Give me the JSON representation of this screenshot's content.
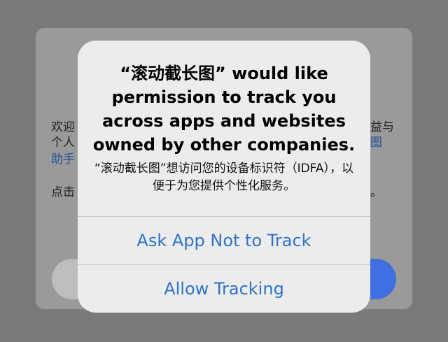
{
  "background": {
    "line1_left": "欢迎",
    "line1_right": "益与",
    "line2_left": "个人",
    "line2_right": "图",
    "line3_left": "助手",
    "line4_left": "点击",
    "line4_right": "。"
  },
  "alert": {
    "title": "“滚动截长图” would like permission to track you across apps and websites owned by other companies.",
    "message": "“滚动截长图”想访问您的设备标识符（IDFA），以便于为您提供个性化服务。",
    "actions": [
      {
        "label": "Ask App Not to Track"
      },
      {
        "label": "Allow Tracking"
      }
    ]
  },
  "colors": {
    "overlay": "#7a7a7a",
    "action_blue": "#2e73c9",
    "bg_primary_button": "#3f6fe0"
  }
}
